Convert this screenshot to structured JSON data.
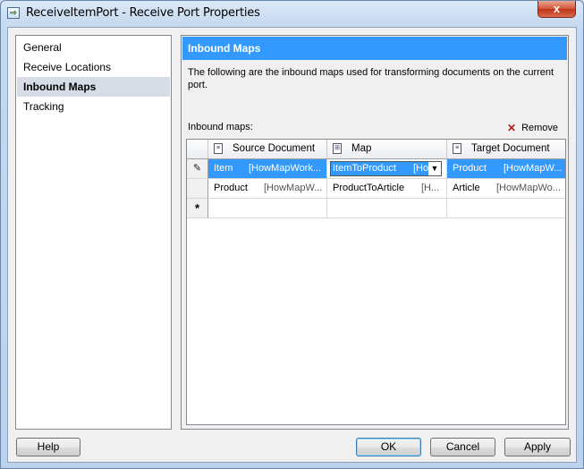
{
  "window": {
    "title": "ReceiveItemPort - Receive Port Properties",
    "close_glyph": "x"
  },
  "nav": {
    "items": [
      {
        "label": "General"
      },
      {
        "label": "Receive Locations"
      },
      {
        "label": "Inbound Maps",
        "selected": true
      },
      {
        "label": "Tracking"
      }
    ]
  },
  "panel": {
    "header": "Inbound Maps",
    "description": "The following are the inbound maps used for transforming documents on the current port.",
    "list_label": "Inbound maps:",
    "remove_label": "Remove"
  },
  "grid": {
    "columns": [
      "Source Document",
      "Map",
      "Target Document"
    ],
    "rows": [
      {
        "selected": true,
        "row_marker": "✎",
        "source": "Item",
        "source_ns": "[HowMapWork...",
        "map": "ItemToProduct",
        "map_ns": "[Ho",
        "target": "Product",
        "target_ns": "[HowMapW..."
      },
      {
        "selected": false,
        "row_marker": "",
        "source": "Product",
        "source_ns": "[HowMapW...",
        "map": "ProductToArticle",
        "map_ns": "[H...",
        "target": "Article",
        "target_ns": "[HowMapWo..."
      }
    ],
    "new_row_marker": "*"
  },
  "buttons": {
    "help": "Help",
    "ok": "OK",
    "cancel": "Cancel",
    "apply": "Apply"
  },
  "colors": {
    "selection": "#3399ff",
    "panel_header": "#3399ff"
  }
}
